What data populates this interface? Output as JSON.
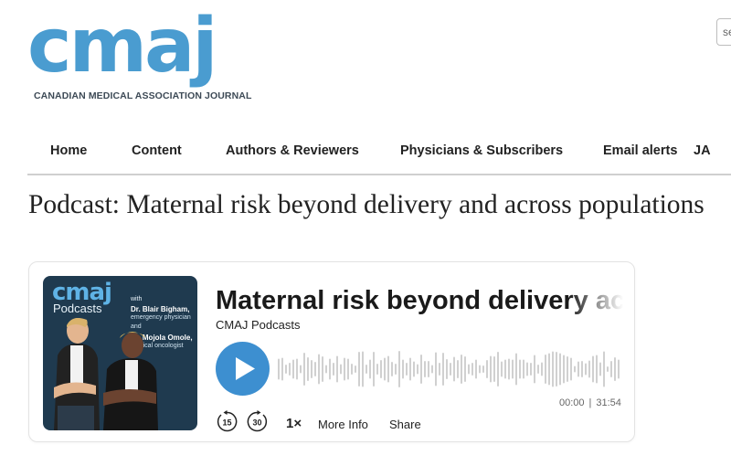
{
  "header": {
    "logo_word": "cmaj",
    "logo_subtitle": "CANADIAN MEDICAL ASSOCIATION JOURNAL",
    "search_placeholder": "se"
  },
  "nav": {
    "items": [
      "Home",
      "Content",
      "Authors & Reviewers",
      "Physicians & Subscribers",
      "Email alerts",
      "JA"
    ]
  },
  "page": {
    "title": "Podcast: Maternal risk beyond delivery and across populations"
  },
  "player": {
    "cover": {
      "brand": "cmaj",
      "label": "Podcasts",
      "with": "with",
      "host1": "Dr. Blair Bigham,",
      "host1_role": "emergency physician",
      "and": "and",
      "host2": "Dr. Mojola Omole,",
      "host2_role": "surgical oncologist"
    },
    "episode_title": "Maternal risk beyond delivery across populations",
    "show_name": "CMAJ Podcasts",
    "current_time": "00:00",
    "duration": "31:54",
    "skip_back": "15",
    "skip_forward": "30",
    "speed": "1×",
    "more_info": "More Info",
    "share": "Share",
    "accent_color": "#3d8fd0",
    "icons": {
      "play": "play-icon",
      "rewind": "rewind-15-icon",
      "forward": "forward-30-icon"
    }
  }
}
